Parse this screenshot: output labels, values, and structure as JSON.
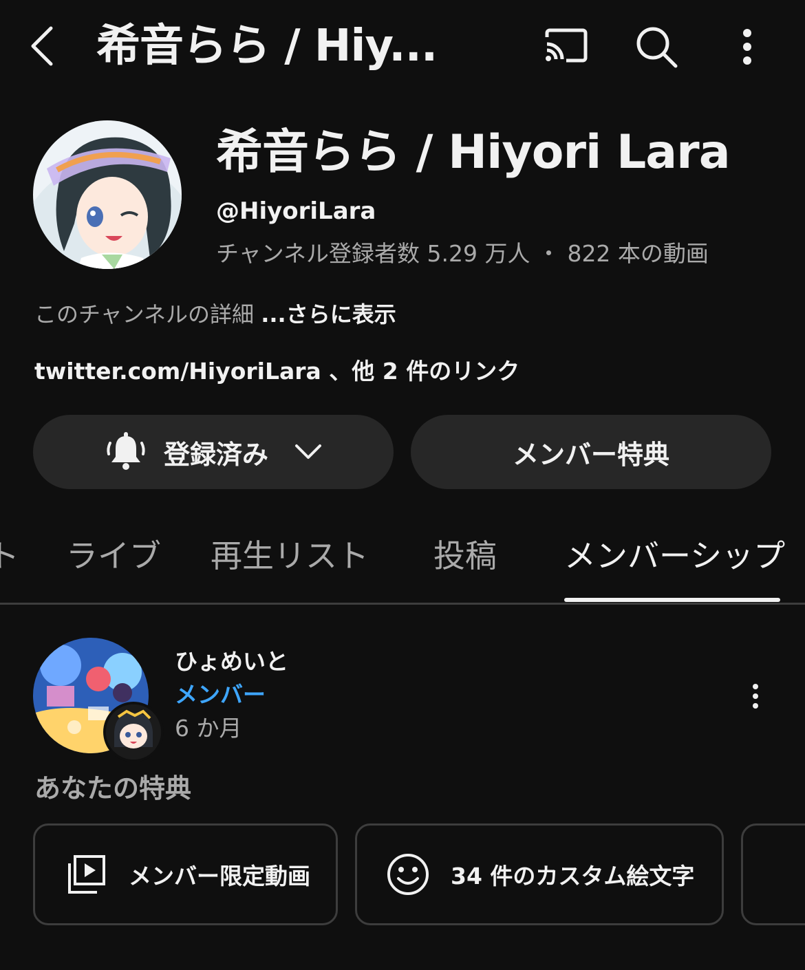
{
  "header": {
    "title": "希音らら / Hiy...",
    "back_icon": "chevron-left-icon",
    "cast_icon": "cast-icon",
    "search_icon": "search-icon",
    "more_icon": "more-vertical-icon"
  },
  "channel": {
    "name": "希音らら / Hiyori Lara",
    "handle": "@HiyoriLara",
    "stats": "チャンネル登録者数 5.29 万人 ・ 822 本の動画",
    "about_text": "このチャンネルの詳細 ",
    "about_more": "...さらに表示",
    "links_text": "twitter.com/HiyoriLara 、他 2 件のリンク"
  },
  "buttons": {
    "subscribed_label": "登録済み",
    "perks_label": "メンバー特典"
  },
  "tabs": [
    {
      "label": "ト"
    },
    {
      "label": "ライブ"
    },
    {
      "label": "再生リスト"
    },
    {
      "label": "投稿"
    },
    {
      "label": "メンバーシップ"
    }
  ],
  "membership": {
    "name": "ひょめいと",
    "level": "メンバー",
    "duration": "6 か月",
    "perks_heading": "あなたの特典",
    "perks": [
      {
        "label": "メンバー限定動画",
        "icon": "video-library-icon"
      },
      {
        "label": "34 件のカスタム絵文字",
        "icon": "smiley-icon"
      }
    ]
  },
  "colors": {
    "background": "#0f0f0f",
    "pill": "#272727",
    "accent_blue": "#3ea6ff",
    "muted_text": "#aaaaaa"
  }
}
